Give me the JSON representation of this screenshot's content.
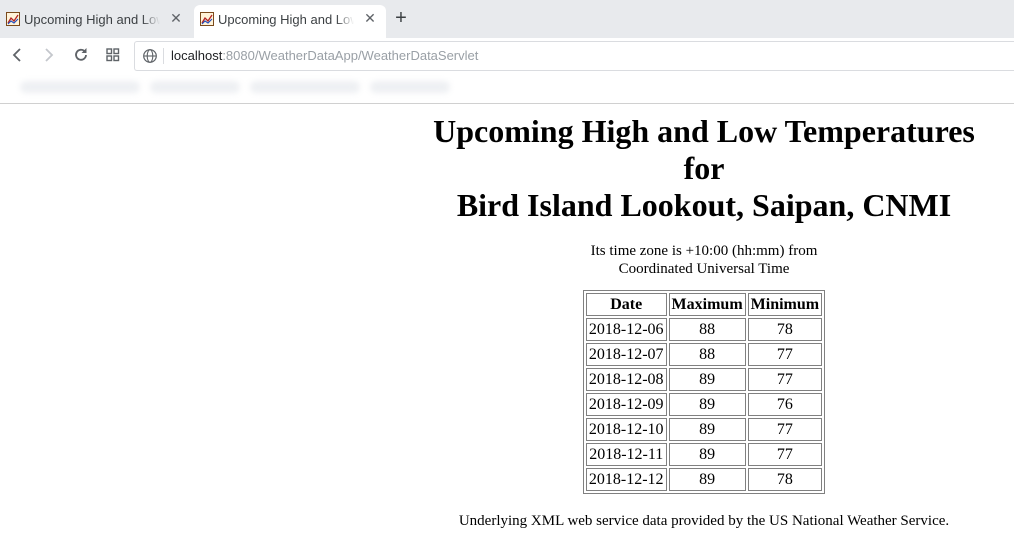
{
  "browser": {
    "tabs": [
      {
        "title": "Upcoming High and Low Temperatures",
        "active": false
      },
      {
        "title": "Upcoming High and Low Temperatures",
        "active": true
      }
    ],
    "url_host": "localhost",
    "url_rest": ":8080/WeatherDataApp/WeatherDataServlet"
  },
  "page": {
    "heading_line1": "Upcoming High and Low Temperatures",
    "heading_line2": "for",
    "heading_line3": "Bird Island Lookout, Saipan, CNMI",
    "timezone_line1": "Its time zone is +10:00 (hh:mm) from",
    "timezone_line2": "Coordinated Universal Time",
    "table": {
      "headers": [
        "Date",
        "Maximum",
        "Minimum"
      ],
      "rows": [
        [
          "2018-12-06",
          "88",
          "78"
        ],
        [
          "2018-12-07",
          "88",
          "77"
        ],
        [
          "2018-12-08",
          "89",
          "77"
        ],
        [
          "2018-12-09",
          "89",
          "76"
        ],
        [
          "2018-12-10",
          "89",
          "77"
        ],
        [
          "2018-12-11",
          "89",
          "77"
        ],
        [
          "2018-12-12",
          "89",
          "78"
        ]
      ]
    },
    "credit": "Underlying XML web service data provided by the US National Weather Service."
  },
  "icons": {
    "tab_favicon": "weather-chart-icon",
    "tab_close": "close-icon",
    "new_tab": "plus-icon",
    "back": "back-arrow-icon",
    "forward": "forward-arrow-icon",
    "reload": "reload-icon",
    "apps": "apps-grid-icon",
    "site_info": "globe-icon"
  }
}
